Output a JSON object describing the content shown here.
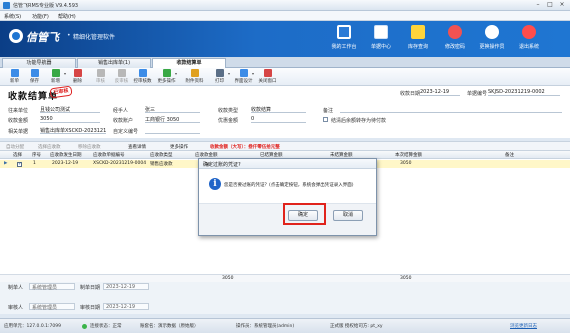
{
  "app": {
    "title": "信管飞RMS专业版 V9.4.593",
    "window_buttons": [
      "–",
      "□",
      "×"
    ]
  },
  "menu": [
    "系统(S)",
    "功能(F)",
    "帮助(H)"
  ],
  "banner": {
    "brand": "信管飞",
    "slogan": "精细化管理软件",
    "buttons": [
      {
        "label": "我的工作台",
        "icon": "monitor-icon",
        "color": "#ffffff"
      },
      {
        "label": "单据中心",
        "icon": "document-center-icon",
        "color": "#ffffff"
      },
      {
        "label": "库存查询",
        "icon": "inventory-icon",
        "color": "#ffd43b"
      },
      {
        "label": "修改密码",
        "icon": "key-icon",
        "color": "#f05252"
      },
      {
        "label": "更换操作员",
        "icon": "switch-user-icon",
        "color": "#ffffff"
      },
      {
        "label": "退出系统",
        "icon": "power-icon",
        "color": "#ff4d4d"
      }
    ]
  },
  "tabs": [
    {
      "label": "功能导航器",
      "active": false
    },
    {
      "label": "销售出库单(1)",
      "active": false
    },
    {
      "label": "收款结算单",
      "active": true
    }
  ],
  "toolbar": [
    {
      "label": "新单",
      "icon": "new-doc-icon",
      "color": "#3c8ce7",
      "enabled": true,
      "arrow": false
    },
    {
      "label": "保存",
      "icon": "save-icon",
      "color": "#3c8ce7",
      "enabled": true,
      "arrow": false
    },
    {
      "label": "新增",
      "icon": "add-icon",
      "color": "#39a845",
      "enabled": true,
      "arrow": true
    },
    {
      "label": "删除",
      "icon": "delete-icon",
      "color": "#d64545",
      "enabled": true,
      "arrow": false
    },
    {
      "label": "审核",
      "icon": "audit-icon",
      "color": "#b8b8b8",
      "enabled": false,
      "arrow": false
    },
    {
      "label": "反审核",
      "icon": "unaudit-icon",
      "color": "#b8b8b8",
      "enabled": false,
      "arrow": false
    },
    {
      "label": "控审核数",
      "icon": "control-icon",
      "color": "#3c8ce7",
      "enabled": true,
      "arrow": false
    },
    {
      "label": "更多操作",
      "icon": "more-icon",
      "color": "#39a845",
      "enabled": true,
      "arrow": true
    },
    {
      "label": "附件资料",
      "icon": "attachment-icon",
      "color": "#e0a020",
      "enabled": true,
      "arrow": false
    },
    {
      "label": "打印",
      "icon": "print-icon",
      "color": "#5a6e86",
      "enabled": true,
      "arrow": true
    },
    {
      "label": "界面设计",
      "icon": "layout-icon",
      "color": "#3c8ce7",
      "enabled": true,
      "arrow": true
    },
    {
      "label": "关闭窗口",
      "icon": "close-window-icon",
      "color": "#d64545",
      "enabled": true,
      "arrow": false
    }
  ],
  "form": {
    "title": "收款结算单",
    "stamp": "已审核",
    "fields": {
      "unit_label": "往来单位",
      "unit_value": "且钱公司测试",
      "handler_label": "经手人",
      "handler_value": "张三",
      "type_label": "收款类型",
      "type_value": "收款结算",
      "remark_label": "备注",
      "amount_label": "收款金额",
      "amount_value": "3050",
      "account_label": "收款账户",
      "account_value": "工商银行 3050",
      "discount_label": "优惠金额",
      "discount_value": "0",
      "option_label": "结清后余额转存为待付款",
      "related_label": "相关单据",
      "related_value": "销售出库单XSCKD-2023121",
      "custom_label": "自定义编号",
      "date_label": "收款日期",
      "date_value": "2023-12-19",
      "number_label": "单据编号",
      "number_value": "SKJSD-20231219-0002"
    }
  },
  "grid_toolbar": {
    "items": [
      {
        "label": "自动分配",
        "enabled": false
      },
      {
        "label": "选择应收款",
        "enabled": false
      },
      {
        "label": "移除应收款",
        "enabled": false
      },
      {
        "label": "查看详情",
        "enabled": true,
        "arrow": true
      },
      {
        "label": "更多操作",
        "enabled": true,
        "arrow": true
      }
    ],
    "notice": "收款金额（大写）：叁仟零伍拾元整"
  },
  "grid": {
    "columns": [
      "选择",
      "序号",
      "应收款发生日期",
      "应收款单据编号",
      "应收款类型",
      "应收款金额",
      "已结算金额",
      "未结算金额",
      "本次结算金额",
      "备注"
    ],
    "rows": [
      {
        "selected": true,
        "no": "1",
        "date": "2023-12-19",
        "doc": "XSCKD-20231219-0004",
        "type": "销售应收款",
        "amount": "",
        "settled": "",
        "unsettled": "",
        "current": "3050",
        "remark": ""
      }
    ],
    "totals": {
      "amount": "3050",
      "current": "3050"
    }
  },
  "bottom": {
    "maker_label": "制单人",
    "maker_value": "系统管理员",
    "make_date_label": "制单日期",
    "make_date_value": "2023-12-19",
    "auditor_label": "审核人",
    "auditor_value": "系统管理员",
    "audit_date_label": "审核日期",
    "audit_date_value": "2023-12-19"
  },
  "status": {
    "server": "应用单元：127.0.0.1:7099",
    "connection": "连接状态：正常",
    "company": "账套名：演示数据（原始版）",
    "operator": "操作员：系统管理员(admin)",
    "license": "正式版 授权给司方: pt_xy",
    "update_link": "浏览更新日志"
  },
  "dialog": {
    "title": "确定过账的凭证?",
    "message": "您是否要过账的凭证？(点击确定按钮，系统会弹出凭证录入界面)",
    "ok_label": "确定",
    "cancel_label": "取消",
    "highlight_color": "#e0231c"
  }
}
